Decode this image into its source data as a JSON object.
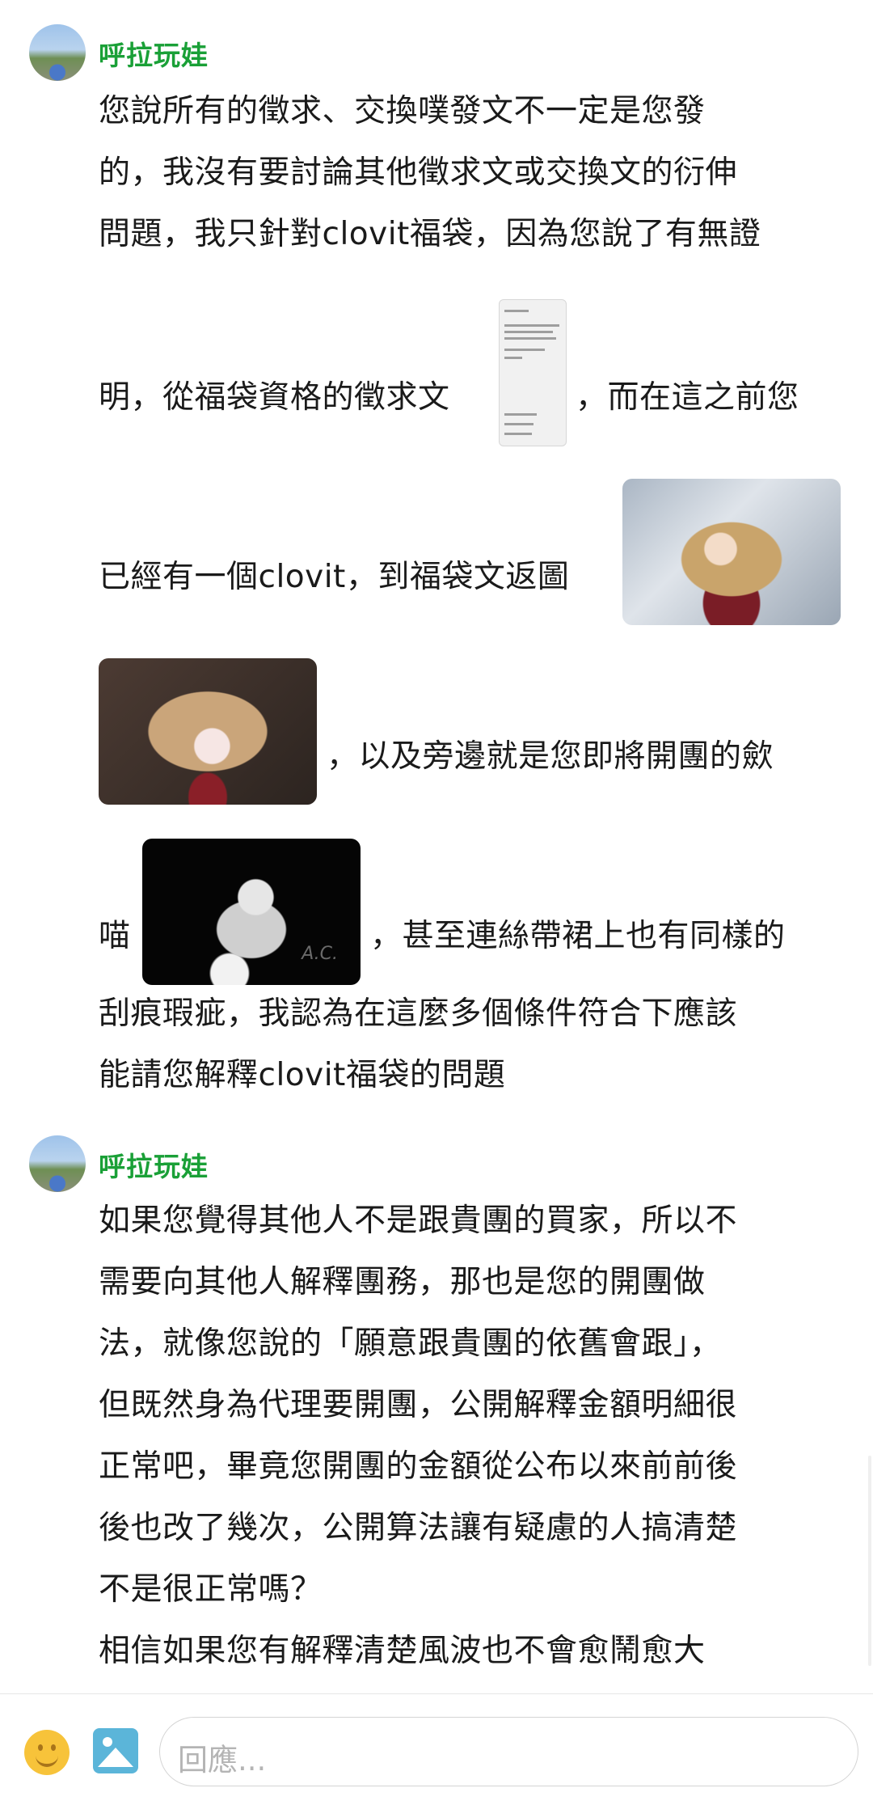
{
  "comments": [
    {
      "username": "呼拉玩娃",
      "lines": [
        "您說所有的徵求、交換噗發文不一定是您發",
        "的，我沒有要討論其他徵求文或交換文的衍伸",
        "問題，我只針對clovit福袋，因為您說了有無證",
        "明，從福袋資格的徵求文",
        "，而在這之前您",
        "已經有一個clovit，到福袋文返圖",
        "，以及旁邊就是您即將開團的歛",
        "喵",
        "，甚至連絲帶裙上也有同樣的",
        "刮痕瑕疵，我認為在這麼多個條件符合下應該",
        "能請您解釋clovit福袋的問題"
      ],
      "watermark": "A.C."
    },
    {
      "username": "呼拉玩娃",
      "lines": [
        "如果您覺得其他人不是跟貴團的買家，所以不",
        "需要向其他人解釋團務，那也是您的開團做",
        "法，就像您說的「願意跟貴團的依舊會跟」，",
        "但既然身為代理要開團，公開解釋金額明細很",
        "正常吧，畢竟您開團的金額從公布以來前前後",
        "後也改了幾次，公開算法讓有疑慮的人搞清楚",
        "不是很正常嗎？",
        "相信如果您有解釋清楚風波也不會愈鬧愈大"
      ]
    }
  ],
  "icons": {
    "emoji": "smiley-face-icon",
    "image": "image-picture-icon"
  },
  "reply_box": {
    "placeholder": "回應..."
  }
}
